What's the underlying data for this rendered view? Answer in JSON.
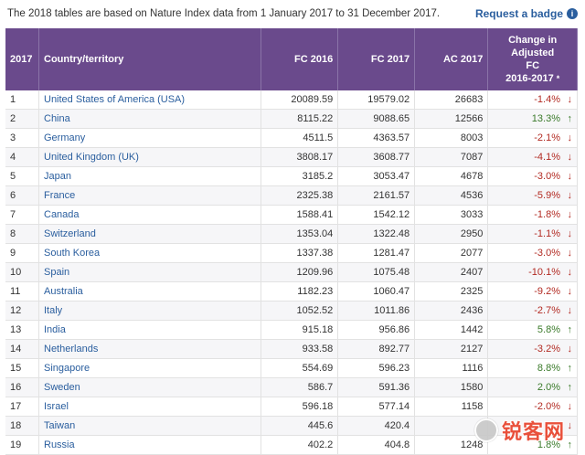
{
  "header": {
    "intro": "The 2018 tables are based on Nature Index data from 1 January 2017 to 31 December 2017.",
    "badge_label": "Request a badge",
    "badge_icon": "info-icon"
  },
  "table": {
    "columns": {
      "rank": "2017",
      "country": "Country/territory",
      "fc2016": "FC 2016",
      "fc2017": "FC 2017",
      "ac2017": "AC 2017",
      "change_line1": "Change in",
      "change_line2": "Adjusted",
      "change_line3": "FC",
      "change_line4": "2016-2017"
    },
    "rows": [
      {
        "rank": "1",
        "country": "United States of America (USA)",
        "fc2016": "20089.59",
        "fc2017": "19579.02",
        "ac2017": "26683",
        "change": "-1.4%",
        "dir": "down"
      },
      {
        "rank": "2",
        "country": "China",
        "fc2016": "8115.22",
        "fc2017": "9088.65",
        "ac2017": "12566",
        "change": "13.3%",
        "dir": "up"
      },
      {
        "rank": "3",
        "country": "Germany",
        "fc2016": "4511.5",
        "fc2017": "4363.57",
        "ac2017": "8003",
        "change": "-2.1%",
        "dir": "down"
      },
      {
        "rank": "4",
        "country": "United Kingdom (UK)",
        "fc2016": "3808.17",
        "fc2017": "3608.77",
        "ac2017": "7087",
        "change": "-4.1%",
        "dir": "down"
      },
      {
        "rank": "5",
        "country": "Japan",
        "fc2016": "3185.2",
        "fc2017": "3053.47",
        "ac2017": "4678",
        "change": "-3.0%",
        "dir": "down"
      },
      {
        "rank": "6",
        "country": "France",
        "fc2016": "2325.38",
        "fc2017": "2161.57",
        "ac2017": "4536",
        "change": "-5.9%",
        "dir": "down"
      },
      {
        "rank": "7",
        "country": "Canada",
        "fc2016": "1588.41",
        "fc2017": "1542.12",
        "ac2017": "3033",
        "change": "-1.8%",
        "dir": "down"
      },
      {
        "rank": "8",
        "country": "Switzerland",
        "fc2016": "1353.04",
        "fc2017": "1322.48",
        "ac2017": "2950",
        "change": "-1.1%",
        "dir": "down"
      },
      {
        "rank": "9",
        "country": "South Korea",
        "fc2016": "1337.38",
        "fc2017": "1281.47",
        "ac2017": "2077",
        "change": "-3.0%",
        "dir": "down"
      },
      {
        "rank": "10",
        "country": "Spain",
        "fc2016": "1209.96",
        "fc2017": "1075.48",
        "ac2017": "2407",
        "change": "-10.1%",
        "dir": "down"
      },
      {
        "rank": "11",
        "country": "Australia",
        "fc2016": "1182.23",
        "fc2017": "1060.47",
        "ac2017": "2325",
        "change": "-9.2%",
        "dir": "down"
      },
      {
        "rank": "12",
        "country": "Italy",
        "fc2016": "1052.52",
        "fc2017": "1011.86",
        "ac2017": "2436",
        "change": "-2.7%",
        "dir": "down"
      },
      {
        "rank": "13",
        "country": "India",
        "fc2016": "915.18",
        "fc2017": "956.86",
        "ac2017": "1442",
        "change": "5.8%",
        "dir": "up"
      },
      {
        "rank": "14",
        "country": "Netherlands",
        "fc2016": "933.58",
        "fc2017": "892.77",
        "ac2017": "2127",
        "change": "-3.2%",
        "dir": "down"
      },
      {
        "rank": "15",
        "country": "Singapore",
        "fc2016": "554.69",
        "fc2017": "596.23",
        "ac2017": "1116",
        "change": "8.8%",
        "dir": "up"
      },
      {
        "rank": "16",
        "country": "Sweden",
        "fc2016": "586.7",
        "fc2017": "591.36",
        "ac2017": "1580",
        "change": "2.0%",
        "dir": "up"
      },
      {
        "rank": "17",
        "country": "Israel",
        "fc2016": "596.18",
        "fc2017": "577.14",
        "ac2017": "1158",
        "change": "-2.0%",
        "dir": "down"
      },
      {
        "rank": "18",
        "country": "Taiwan",
        "fc2016": "445.6",
        "fc2017": "420.4",
        "ac2017": "",
        "change": "",
        "dir": "down"
      },
      {
        "rank": "19",
        "country": "Russia",
        "fc2016": "402.2",
        "fc2017": "404.8",
        "ac2017": "1248",
        "change": "1.8%",
        "dir": "up"
      }
    ]
  },
  "watermark": {
    "text": "锐客网"
  },
  "colors": {
    "header_bg": "#6a4a8c",
    "link": "#2a5e9e",
    "negative": "#b22a22",
    "positive": "#3a7a2a"
  }
}
